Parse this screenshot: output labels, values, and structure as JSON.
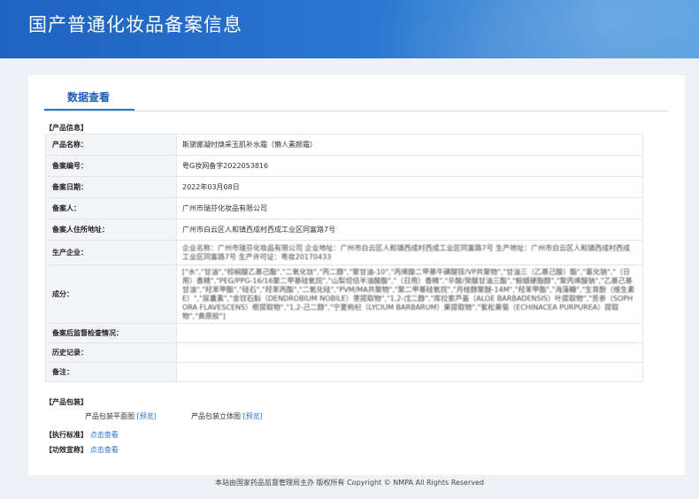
{
  "header": {
    "title": "国产普通化妆品备案信息"
  },
  "tabs": {
    "active": "数据查看"
  },
  "sections": {
    "product_info": "【产品信息】",
    "packaging": "【产品包装】",
    "standard": "【执行标准】",
    "efficacy": "【功效宣称】"
  },
  "rows": {
    "name": {
      "label": "产品名称：",
      "value": "斯黛娜凝时焕采玉肌补水霜（懒人素颜霜）"
    },
    "record_no": {
      "label": "备案编号：",
      "value": "粤G妆网备字2022053816"
    },
    "record_date": {
      "label": "备案日期：",
      "value": "2022年03月08日"
    },
    "filer": {
      "label": "备案人：",
      "value": "广州市瑞芬化妆品有限公司"
    },
    "address": {
      "label": "备案人住所地址：",
      "value": "广州市白云区人和镇西成村西成工业区同富路7号"
    },
    "producer": {
      "label": "生产企业：",
      "value": "企业名称：广州市瑞芬化妆品有限公司 企业地址：广州市白云区人和镇西成村西成工业区同富路7号 生产地址：广州市白云区人和镇西成村西成工业区同富路7号 生产许可证：粤妆20170433"
    },
    "ingredients": {
      "label": "成分：",
      "value": "[\"水\",\"甘油\",\"棕榈酸乙基己酯\",\"二氧化钛\",\"丙二醇\",\"聚甘油-10\",\"丙烯酸二甲基牛磺酸铵/VP共聚物\",\"甘油三（乙基己酸）酯\",\"氯化钠\",\"（日用）香精\",\"PEG/PPG-16/16聚二甲基硅氧烷\",\"山梨坦倍半油酸酯\",\"（日用）香精\",\"辛酸/癸酸甘油三酯\",\"鲸蜡硬脂醇\",\"聚丙烯酸钠\",\"乙基己基甘油\",\"羟苯甲酯\",\"硅石\",\"羟苯丙酯\",\"二氧化硅\",\"PVM/MA共聚物\",\"聚二甲基硅氧烷\",\"月桂醇聚醚-14M\",\"羟苯甲酯\",\"海藻糖\",\"生育酚（维生素E）\",\"尿囊素\",\"金钗石斛（DENDROBIUM NOBILE）茎提取物\",\"1,2-戊二醇\",\"库拉索芦荟（ALOE BARBADENSIS）叶提取物\",\"苦参（SOPHORA FLAVESCENS）根提取物\",\"1,2-己二醇\",\"宁夏枸杞（LYCIUM BARBARUM）果提取物\",\"紫松果菊（ECHINACEA PURPUREA）提取物\",\"黄原胶\"]"
    },
    "inspection": {
      "label": "备案后监督检查情况：",
      "value": ""
    },
    "history": {
      "label": "历史记录：",
      "value": ""
    },
    "remarks": {
      "label": "备注：",
      "value": ""
    }
  },
  "packaging": {
    "flat_label": "产品包装平面图",
    "solid_label": "产品包装立体图",
    "preview_link": "[预览]"
  },
  "standard_link": "点击查看",
  "efficacy_link": "点击查看",
  "footer": "本站由国家药品监督管理局主办 版权所有 Copyright © NMPA All Rights Reserved"
}
